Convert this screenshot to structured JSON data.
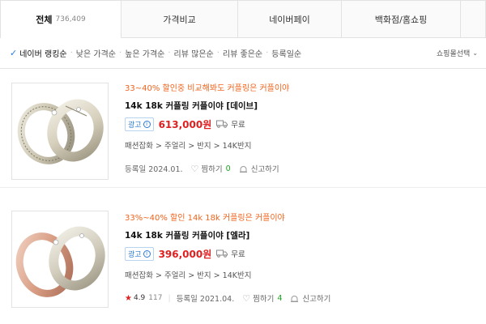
{
  "tabs": [
    {
      "label": "전체",
      "count": "736,409"
    },
    {
      "label": "가격비교"
    },
    {
      "label": "네이버페이"
    },
    {
      "label": "백화점/홈쇼핑"
    },
    {
      "label": ""
    }
  ],
  "sort": {
    "items": [
      "네이버 랭킹순",
      "낮은 가격순",
      "높은 가격순",
      "리뷰 많은순",
      "리뷰 좋은순",
      "등록일순"
    ],
    "shop_select": "쇼핑몰선택"
  },
  "products": [
    {
      "promo": "33~40% 할인중 비교해봐도 커플링은 커플이야",
      "name": "14k 18k 커플링 커플이야 [데이브]",
      "ad": "광고",
      "price": "613,000원",
      "shipping": "무료",
      "category": "패션잡화 > 주얼리 > 반지 > 14K반지",
      "registered": "등록일 2024.01.",
      "zzim": "찜하기",
      "zzim_count": "0",
      "report": "신고하기"
    },
    {
      "promo": "33%~40% 할인 14k 18k 커플링은 커플이야",
      "name": "14k 18k 커플링 커플이야 [엘라]",
      "ad": "광고",
      "price": "396,000원",
      "shipping": "무료",
      "category": "패션잡화 > 주얼리 > 반지 > 14K반지",
      "rating": "4.9",
      "rating_count": "117",
      "registered": "등록일 2021.04.",
      "zzim": "찜하기",
      "zzim_count": "4",
      "report": "신고하기"
    }
  ],
  "colors": {
    "promo": "#f0641e",
    "price": "#e02020",
    "accent": "#2b7ee0",
    "zzim_count": "#1aa51a"
  }
}
